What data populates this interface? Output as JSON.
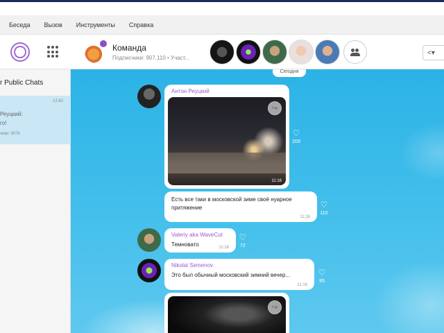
{
  "menu": {
    "items": [
      "Беседа",
      "Вызов",
      "Инструменты",
      "Справка"
    ]
  },
  "sidebar": {
    "title": "r Public Chats",
    "chat": {
      "time": "12:42",
      "line1": "Реуцкий:",
      "line2": "го!",
      "line3": "чики: 907k"
    }
  },
  "header": {
    "group_name": "Команда",
    "subtitle": "Подписчики: 907,110 • Участ...",
    "share_icon": "share-icon"
  },
  "chat": {
    "date_label": "Сегодня",
    "messages": [
      {
        "sender": "Антон Реуцкий",
        "type": "photo",
        "time": "11:16",
        "likes": "209"
      },
      {
        "text": "Есть все таки в московской зиме своё нуарное притяжение",
        "time": "11:16",
        "likes": "110"
      },
      {
        "sender": "Valeriy aka WaveCut",
        "text": "Темновато",
        "time": "11:16",
        "likes": "72"
      },
      {
        "sender": "Nikolai Semenov",
        "text": "Это был обычный московский зимний вечер...",
        "time": "11:18",
        "likes": "95"
      }
    ]
  },
  "colors": {
    "accent": "#9b59d0",
    "chat_bg": "#2bb3e6",
    "selected": "#c9e7f5"
  }
}
